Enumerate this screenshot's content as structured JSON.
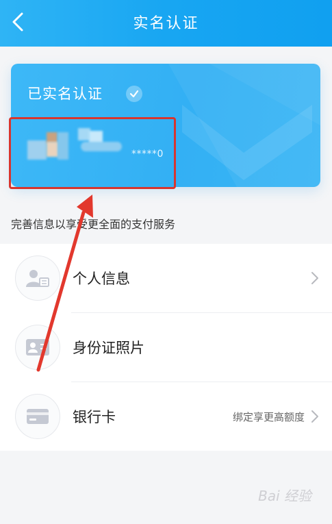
{
  "header": {
    "title": "实名认证",
    "back_icon": "chevron-left-icon"
  },
  "card": {
    "status_text": "已实名认证",
    "masked_id": "*****0",
    "status_icon": "check-icon"
  },
  "hint_text": "完善信息以享受更全面的支付服务",
  "list": {
    "items": [
      {
        "label": "个人信息",
        "icon": "person-card-icon",
        "sub": ""
      },
      {
        "label": "身份证照片",
        "icon": "id-card-icon",
        "sub": ""
      },
      {
        "label": "银行卡",
        "icon": "bank-card-icon",
        "sub": "绑定享更高额度"
      }
    ]
  },
  "watermark": "Bai 经验",
  "colors": {
    "header_gradient": [
      "#2fb4f5",
      "#10a0f0"
    ],
    "card_blue": "#35b2f5",
    "highlight_red": "#d8352e"
  }
}
